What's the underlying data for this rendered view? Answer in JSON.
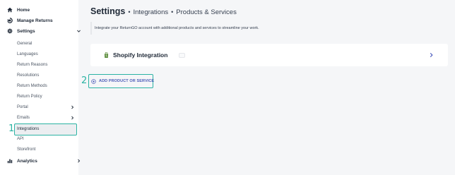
{
  "sidebar": {
    "home": "Home",
    "manage_returns": "Manage Returns",
    "settings": "Settings",
    "sub_items": [
      "General",
      "Languages",
      "Return Reasons",
      "Resolutions",
      "Return Methods",
      "Return Policy",
      "Portal",
      "Emails",
      "Integrations",
      "API",
      "Storefront"
    ],
    "analytics": "Analytics"
  },
  "header": {
    "title": "Settings",
    "separator": "•",
    "breadcrumb_1": "Integrations",
    "breadcrumb_2": "Products & Services"
  },
  "main": {
    "description": "Integrate your ReturnGO account with additional products and services to streamline your work.",
    "integration_card_title": "Shopify Integration",
    "add_button_label": "ADD PRODUCT OR SERVICE"
  },
  "annotations": {
    "step_1": "1",
    "step_2": "2"
  },
  "colors": {
    "highlight": "#2bb3a3",
    "button_text": "#4b5bb8",
    "shopify_green": "#5e8e3e"
  }
}
